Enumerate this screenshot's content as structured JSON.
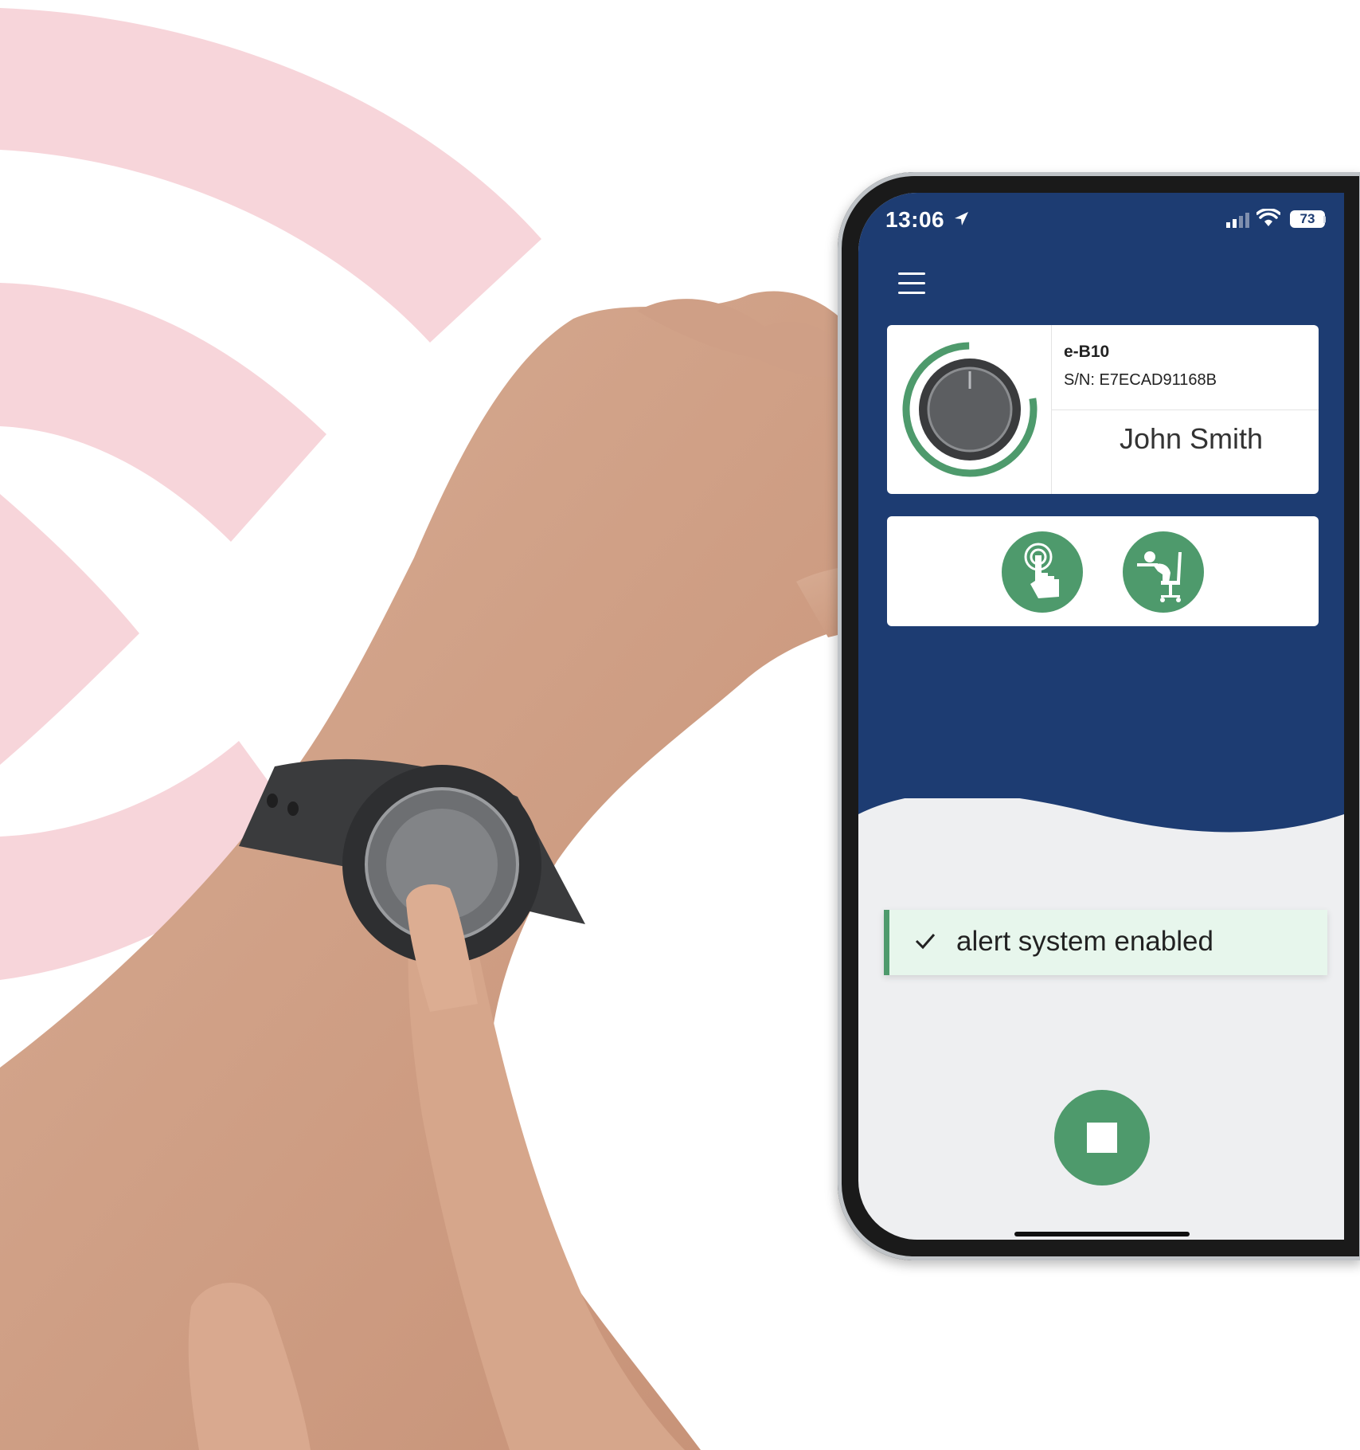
{
  "colors": {
    "brand_navy": "#1d3c72",
    "accent_green": "#4e9a6c",
    "toast_background": "#e7f6ec",
    "signal_pink": "#f7d5da"
  },
  "status_bar": {
    "time": "13:06",
    "battery": "73",
    "icons": [
      "location-arrow-icon",
      "cellular-signal-icon",
      "wifi-icon",
      "battery-icon"
    ]
  },
  "header": {
    "menu_icon": "hamburger-menu-icon"
  },
  "device_card": {
    "model": "e-B10",
    "serial": "S/N: E7ECAD91168B",
    "user_name": "John Smith",
    "image_icon": "wristband-knob-icon"
  },
  "alert_modes": [
    {
      "name": "manual-alert",
      "icon": "hand-press-icon"
    },
    {
      "name": "fall-detection",
      "icon": "person-slumped-chair-icon"
    }
  ],
  "toast": {
    "icon": "check-icon",
    "message": "alert system enabled"
  },
  "controls": {
    "stop_icon": "stop-square-icon"
  }
}
